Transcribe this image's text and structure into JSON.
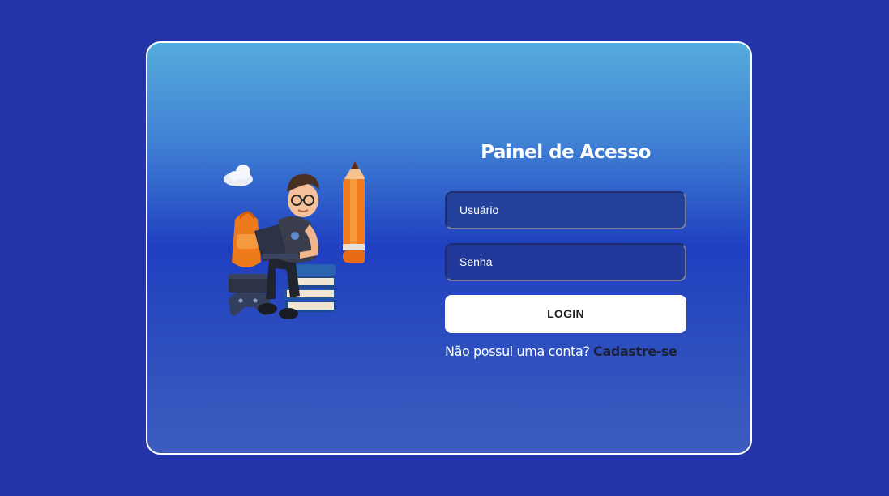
{
  "login_card": {
    "title": "Painel de Acesso",
    "username_placeholder": "Usuário",
    "password_placeholder": "Senha",
    "login_label": "LOGIN",
    "signup_prompt": "Não possui uma conta?",
    "signup_link": "Cadastre-se"
  },
  "illustration": {
    "icon": "student-with-laptop-illustration"
  },
  "colors": {
    "page_background": "#2234a8",
    "card_gradient_top": "#56acdc",
    "card_gradient_middle": "#1f3fc0",
    "input_background": "#23409a",
    "button_background": "#ffffff",
    "link_color": "#1b1f3a"
  }
}
